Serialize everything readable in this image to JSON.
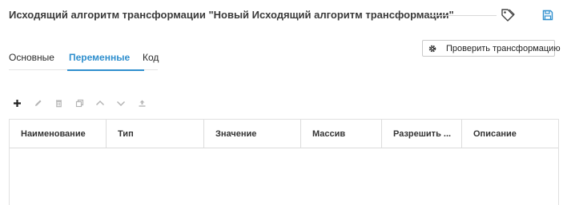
{
  "header": {
    "title": "Исходящий алгоритм трансформации \"Новый Исходящий алгоритм трансформации\"",
    "tag_icon": "tag-icon",
    "save_icon": "floppy-disk-icon"
  },
  "actions": {
    "check_transform_label": "Проверить трансформацию",
    "check_transform_icon": "gear-icon"
  },
  "tabs": [
    {
      "label": "Основные",
      "active": false
    },
    {
      "label": "Переменные",
      "active": true
    },
    {
      "label": "Код",
      "active": false
    }
  ],
  "toolbar": {
    "icons": [
      "plus-icon",
      "pencil-icon",
      "trash-icon",
      "copy-icon",
      "chevron-up-icon",
      "chevron-down-icon",
      "upload-icon"
    ]
  },
  "table": {
    "columns": [
      "Наименование",
      "Тип",
      "Значение",
      "Массив",
      "Разрешить ...",
      "Описание"
    ],
    "rows": []
  },
  "colors": {
    "accent": "#2f8fce",
    "disabled_icon": "#b5b5b5"
  }
}
